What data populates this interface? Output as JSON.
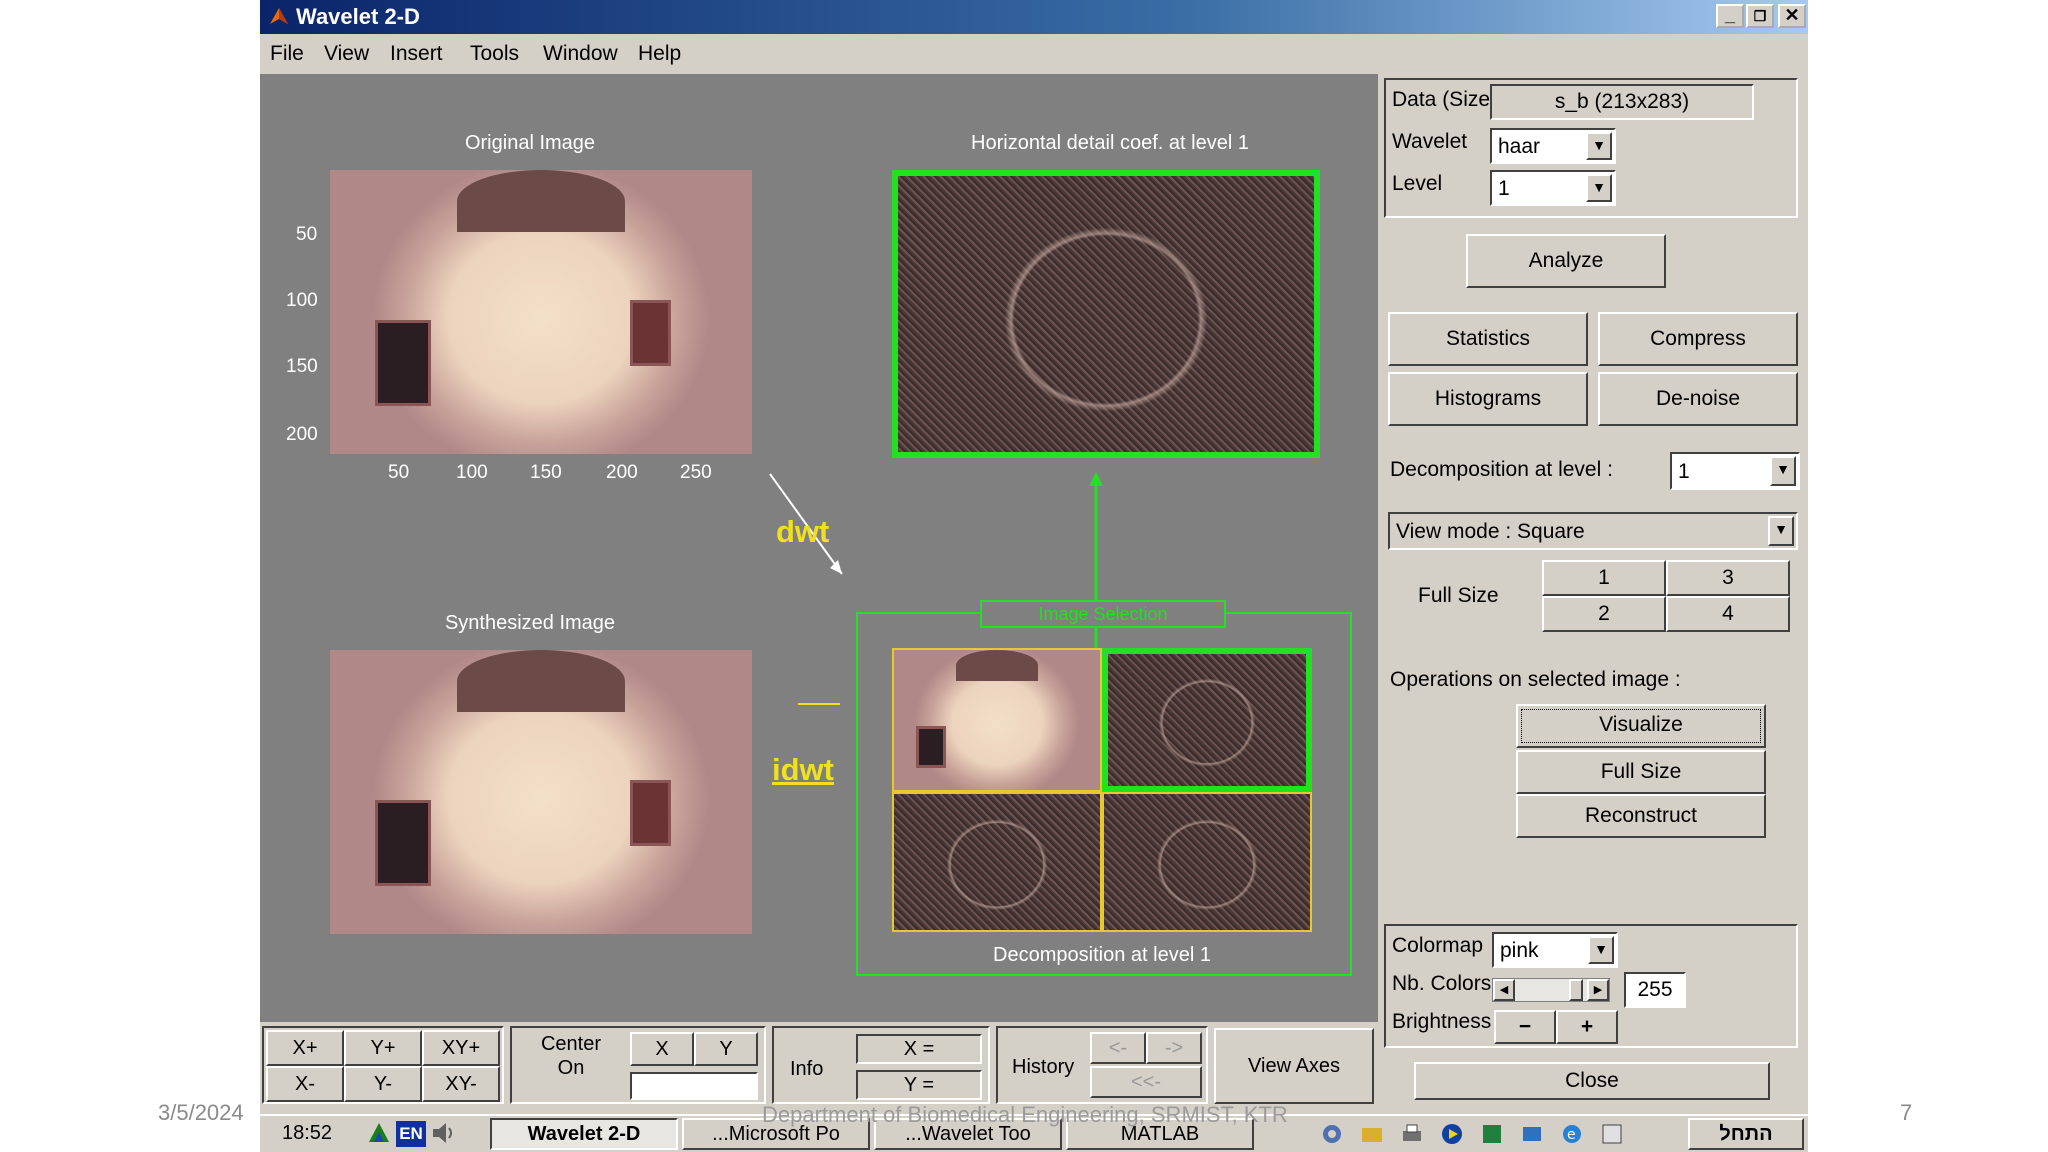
{
  "window": {
    "title": "Wavelet 2-D",
    "controls": [
      "_",
      "❐",
      "✕"
    ]
  },
  "menu": [
    "File",
    "View",
    "Insert",
    "Tools",
    "Window",
    "Help"
  ],
  "plots": {
    "original_title": "Original Image",
    "synth_title": "Synthesized Image",
    "horiz_title": "Horizontal detail coef. at level 1",
    "decomp_title": "Decomposition at level 1",
    "selection_label": "Image Selection",
    "y_ticks": [
      "50",
      "100",
      "150",
      "200"
    ],
    "x_ticks": [
      "50",
      "100",
      "150",
      "200",
      "250"
    ],
    "dwt_label": "dwt",
    "idwt_label": "idwt"
  },
  "panel": {
    "data_size_label": "Data  (Size)",
    "data_size_value": "s_b  (213x283)",
    "wavelet_label": "Wavelet",
    "wavelet_value": "haar",
    "level_label": "Level",
    "level_value": "1",
    "analyze": "Analyze",
    "statistics": "Statistics",
    "compress": "Compress",
    "histograms": "Histograms",
    "denoise": "De-noise",
    "decomp_level_label": "Decomposition at level :",
    "decomp_level_value": "1",
    "view_mode": "View mode : Square",
    "full_size_label": "Full Size",
    "fs_buttons": [
      "1",
      "3",
      "2",
      "4"
    ],
    "ops_label": "Operations on selected image :",
    "visualize": "Visualize",
    "full_size_btn": "Full Size",
    "reconstruct": "Reconstruct",
    "colormap_label": "Colormap",
    "colormap_value": "pink",
    "nb_colors_label": "Nb. Colors",
    "nb_colors_value": "255",
    "brightness_label": "Brightness",
    "minus": "−",
    "plus": "+",
    "close": "Close"
  },
  "toolbar": {
    "xplus": "X+",
    "yplus": "Y+",
    "xyplus": "XY+",
    "xminus": "X-",
    "yminus": "Y-",
    "xyminus": "XY-",
    "center_on": "Center\nOn",
    "x": "X",
    "y": "Y",
    "info": "Info",
    "x_eq": "X =",
    "y_eq": "Y =",
    "history": "History",
    "back": "<-",
    "forward": "->",
    "rewind": "<<-",
    "view_axes": "View Axes"
  },
  "taskbar": {
    "clock": "18:52",
    "lang": "EN",
    "tasks": [
      "Wavelet 2-D",
      "...Microsoft Po",
      "...Wavelet Too",
      "MATLAB"
    ],
    "start_label": "התחל"
  },
  "slide": {
    "date": "3/5/2024",
    "footer": "Department of Biomedical Engineering, SRMIST, KTR",
    "page": "7"
  },
  "colors": {
    "title_bar": "#0a246a",
    "figure_bg": "#808080",
    "selection_green": "#22e022",
    "arrow_yellow": "#f0e020"
  }
}
